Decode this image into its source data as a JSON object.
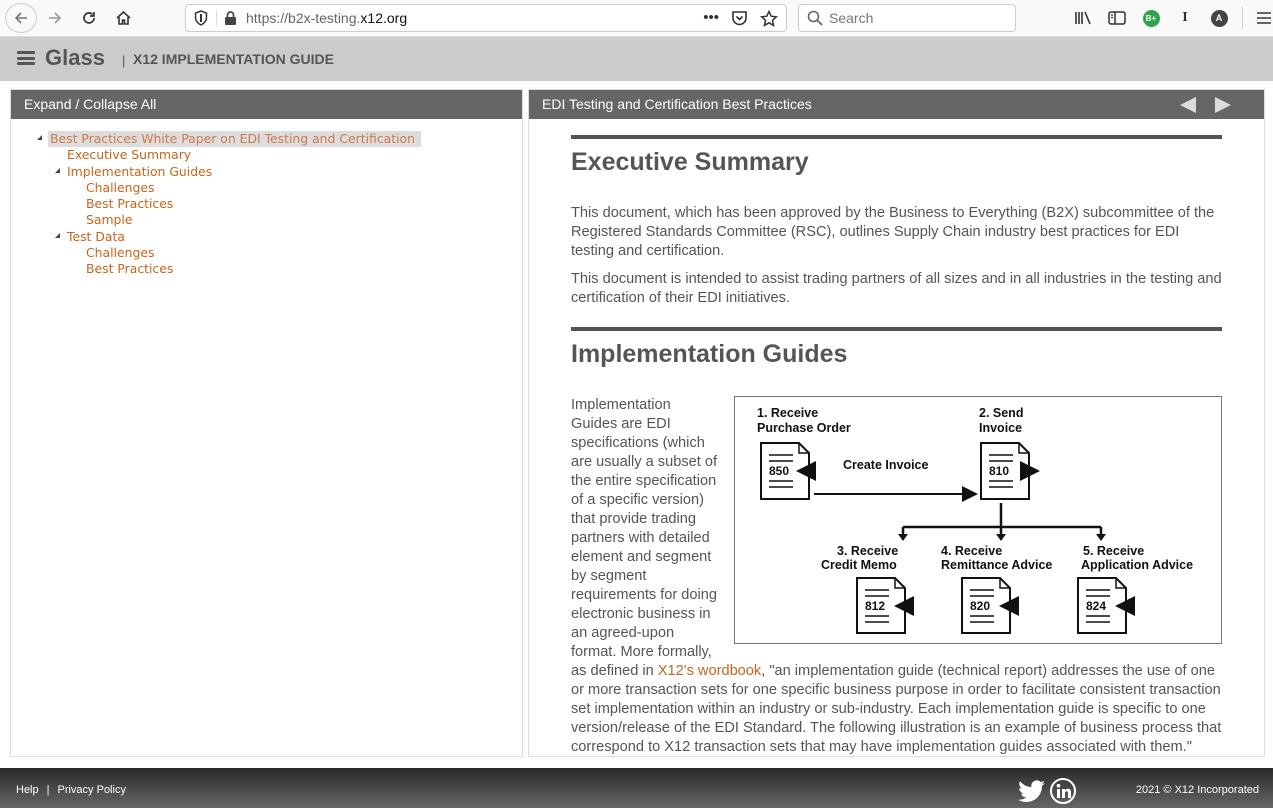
{
  "browser": {
    "url_prefix": "https://b2x-testing.",
    "url_domain": "x12.org",
    "search_placeholder": "Search",
    "more_label": "•••",
    "toolbar_badge_green": "B+",
    "toolbar_text_icon": "I",
    "toolbar_avatar": "A"
  },
  "app": {
    "brand": "Glass",
    "separator": "|",
    "subtitle": "X12 IMPLEMENTATION GUIDE"
  },
  "left_panel": {
    "header": "Expand / Collapse All",
    "tree": [
      {
        "label": "Best Practices White Paper on EDI Testing and Certification",
        "level": 0,
        "expandable": true,
        "selected": true
      },
      {
        "label": "Executive Summary",
        "level": 1,
        "expandable": false
      },
      {
        "label": "Implementation Guides",
        "level": 1,
        "expandable": true
      },
      {
        "label": "Challenges",
        "level": 2,
        "expandable": false
      },
      {
        "label": "Best Practices",
        "level": 2,
        "expandable": false
      },
      {
        "label": "Sample",
        "level": 2,
        "expandable": false
      },
      {
        "label": "Test Data",
        "level": 1,
        "expandable": true
      },
      {
        "label": "Challenges",
        "level": 2,
        "expandable": false
      },
      {
        "label": "Best Practices",
        "level": 2,
        "expandable": false
      }
    ]
  },
  "right_panel": {
    "header": "EDI Testing and Certification Best Practices",
    "sections": {
      "exec_summary": {
        "title": "Executive Summary",
        "paragraphs": [
          "This document, which has been approved by the Business to Everything (B2X) subcommittee of the Registered Standards Committee (RSC), outlines Supply Chain industry best practices for EDI testing and certification.",
          "This document is intended to assist trading partners of all sizes and in all industries in the testing and certification of their EDI initiatives."
        ]
      },
      "impl_guides": {
        "title": "Implementation Guides",
        "text_before_link": "Implementation Guides are EDI specifications (which are usually a subset of the entire specification of a specific version) that provide trading partners with detailed element and segment by segment requirements for doing electronic business in an agreed-upon format. More formally, as defined in ",
        "link_text": "X12's wordbook",
        "text_after_link": ", \"an implementation guide (technical report) addresses the use of one or more transaction sets for one specific business purpose in order to facilitate consistent transaction set implementation within an industry or sub-industry. Each implementation guide is specific to one version/release of the EDI Standard. The following illustration is an example of business process that correspond to X12 transaction sets that may have implementation guides associated with them.\""
      }
    },
    "diagram": {
      "action_label": "Create Invoice",
      "steps": [
        {
          "line1": "1. Receive",
          "line2": "Purchase Order",
          "code": "850"
        },
        {
          "line1": "2. Send",
          "line2": "Invoice",
          "code": "810"
        },
        {
          "line1": "3. Receive",
          "line2": "Credit Memo",
          "code": "812"
        },
        {
          "line1": "4. Receive",
          "line2": "Remittance Advice",
          "code": "820"
        },
        {
          "line1": "5. Receive",
          "line2": "Application Advice",
          "code": "824"
        }
      ]
    }
  },
  "footer": {
    "help": "Help",
    "separator": "|",
    "privacy": "Privacy Policy",
    "copyright": "2021 © X12 Incorporated"
  }
}
